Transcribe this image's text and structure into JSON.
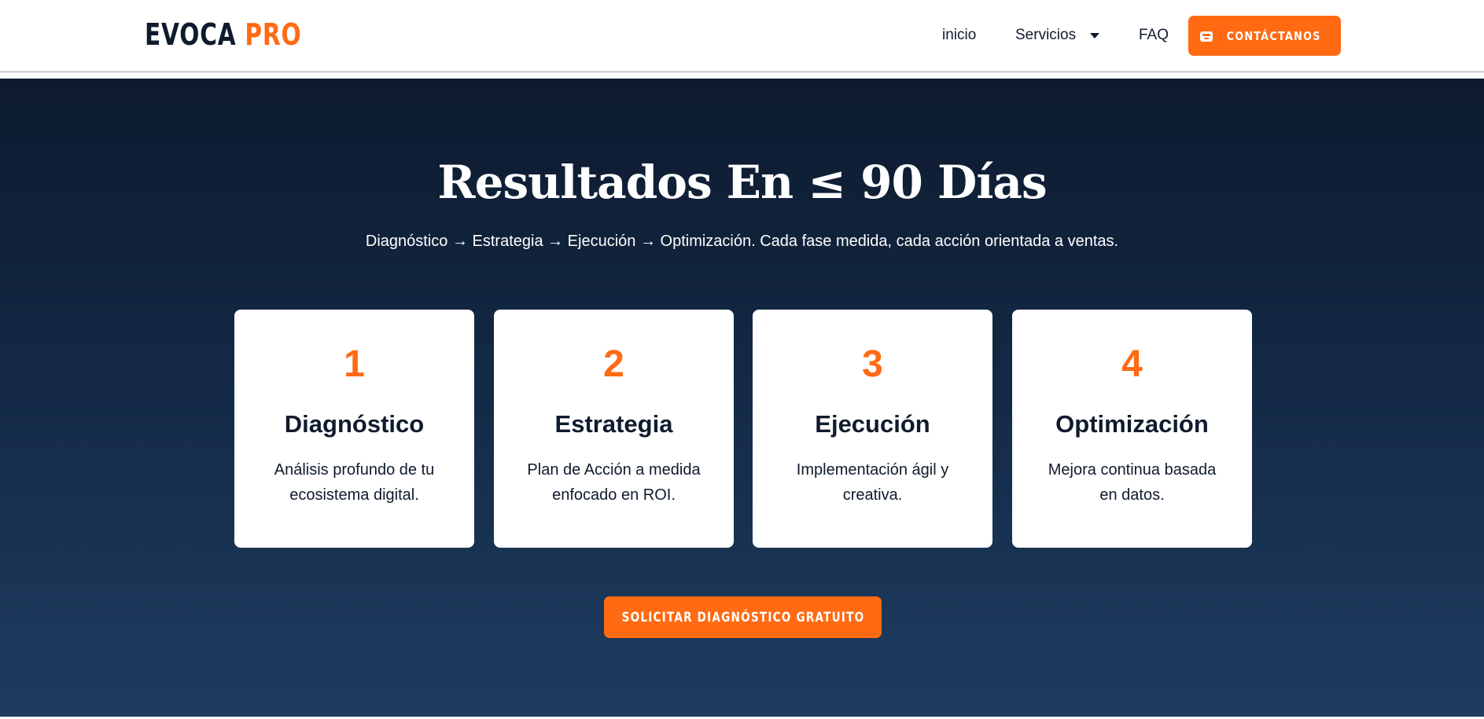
{
  "brand": {
    "logo_part1": "EVOCA",
    "logo_part2": "PRO",
    "accent_color": "#ff6a13",
    "dark_color": "#0f1b2d"
  },
  "nav": {
    "items": [
      {
        "label": "inicio"
      },
      {
        "label": "Servicios",
        "has_dropdown": true
      },
      {
        "label": "FAQ"
      }
    ],
    "contact_button": {
      "label": "CONTÁCTANOS",
      "icon": "mailbox-icon"
    }
  },
  "hero": {
    "title": "Resultados En ≤ 90 Días",
    "subtitle": "Diagnóstico → Estrategia → Ejecución → Optimización. Cada fase medida, cada acción orientada a ventas.",
    "background_gradient": [
      "#0d1a2e",
      "#1e3c60"
    ]
  },
  "steps": [
    {
      "number": "1",
      "title": "Diagnóstico",
      "description": "Análisis profundo de tu ecosistema digital."
    },
    {
      "number": "2",
      "title": "Estrategia",
      "description": "Plan de Acción a medida enfocado en ROI."
    },
    {
      "number": "3",
      "title": "Ejecución",
      "description": "Implementación ágil y creativa."
    },
    {
      "number": "4",
      "title": "Optimización",
      "description": "Mejora continua basada en datos."
    }
  ],
  "cta": {
    "label": "SOLICITAR DIAGNÓSTICO GRATUITO"
  }
}
